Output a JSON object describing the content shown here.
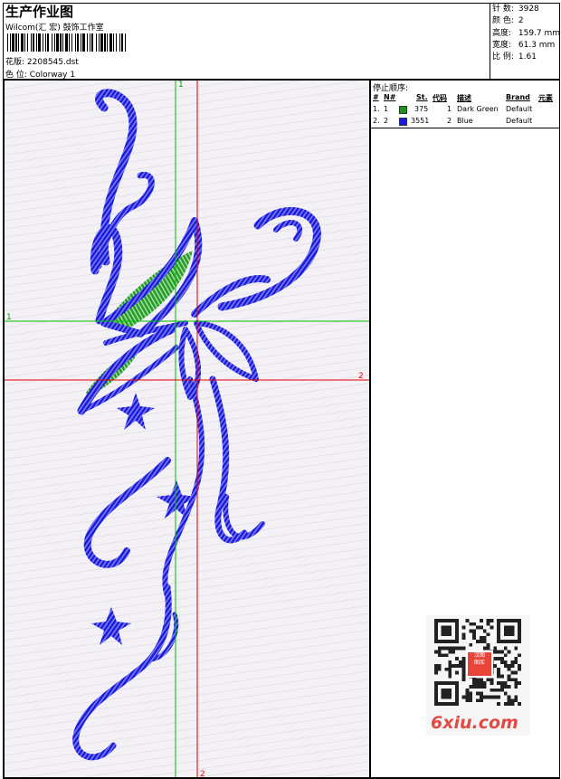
{
  "header": {
    "title": "生产作业图",
    "company": "Wilcom(汇 宏) 鼓饰工作室",
    "design_label": "花版:",
    "design_value": "2208545.dst",
    "colorway_label": "色 位:",
    "colorway_value": "Colorway 1"
  },
  "stats": [
    {
      "label": "针 数:",
      "value": "3928"
    },
    {
      "label": "颜 色:",
      "value": "2"
    },
    {
      "label": "高度:",
      "value": "159.7 mm"
    },
    {
      "label": "宽度:",
      "value": "61.3 mm"
    },
    {
      "label": "比 例:",
      "value": "1.61"
    }
  ],
  "stop_sequence": {
    "heading": "停止顺序:",
    "columns": [
      "#",
      "N#",
      "St.",
      "代码",
      "描述",
      "Brand",
      "元素"
    ],
    "rows": [
      {
        "idx": "1.",
        "n": "1",
        "color": "#1f8f1f",
        "stitches": "375",
        "code": "1",
        "desc": "Dark Green",
        "brand": "Default"
      },
      {
        "idx": "2.",
        "n": "2",
        "color": "#1a1adc",
        "stitches": "3551",
        "code": "2",
        "desc": "Blue",
        "brand": "Default"
      }
    ]
  },
  "guides": {
    "green_v_label": "1",
    "green_h_label": "1",
    "red_h_label": "2",
    "red_v_label": "2"
  },
  "colors": {
    "thread_blue": "#1a1adc",
    "thread_green": "#2a9a2a",
    "guide_green": "#00c000",
    "guide_red": "#e00000",
    "site_red": "#e24a45"
  },
  "watermark": {
    "badge_text": "汉图\n图库",
    "site": "6xiu.com"
  }
}
